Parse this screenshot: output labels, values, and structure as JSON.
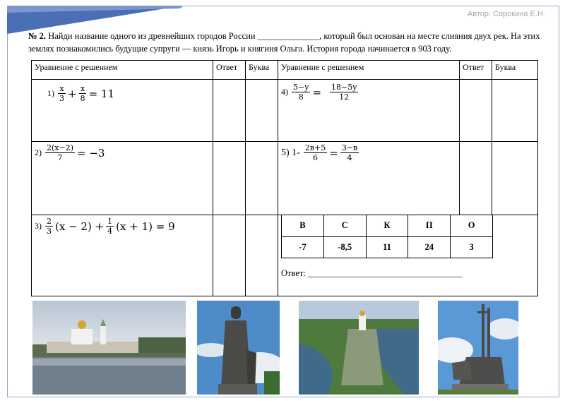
{
  "author": "Автор: Сорокина Е.Н.",
  "task": {
    "number": "№ 2.",
    "text": "Найди название одного из древнейших городов России ______________, который был основан на месте слияния двух рек. На этих землях познакомились будущие супруги — князь Игорь и княгиня Ольга. История города начинается в 903 году."
  },
  "table": {
    "headers": [
      "Уравнение с решением",
      "Ответ",
      "Буква",
      "Уравнение с решением",
      "Ответ",
      "Буква"
    ],
    "eq1": {
      "label": "1)",
      "n1": "x",
      "d1": "3",
      "plus": "+",
      "n2": "x",
      "d2": "8",
      "rhs": "= 11"
    },
    "eq2": {
      "label": "2)",
      "n": "2(x−2)",
      "d": "7",
      "rhs": "= −3"
    },
    "eq3": {
      "label": "3)",
      "n1": "2",
      "d1": "3",
      "mid": "(x − 2) +",
      "n2": "1",
      "d2": "4",
      "rhs": "(x + 1) = 9"
    },
    "eq4": {
      "label": "4)",
      "n1": "5−y",
      "d1": "8",
      "eq": "=",
      "n2": "18−5y",
      "d2": "12"
    },
    "eq5": {
      "label": "5) 1-",
      "n1": "2в+5",
      "d1": "6",
      "eq": "=",
      "n2": "3−в",
      "d2": "4"
    }
  },
  "key": {
    "letters": [
      "В",
      "С",
      "К",
      "П",
      "О"
    ],
    "values": [
      "-7",
      "-8,5",
      "11",
      "24",
      "3"
    ]
  },
  "answer_label": "Ответ: ___________________________________"
}
